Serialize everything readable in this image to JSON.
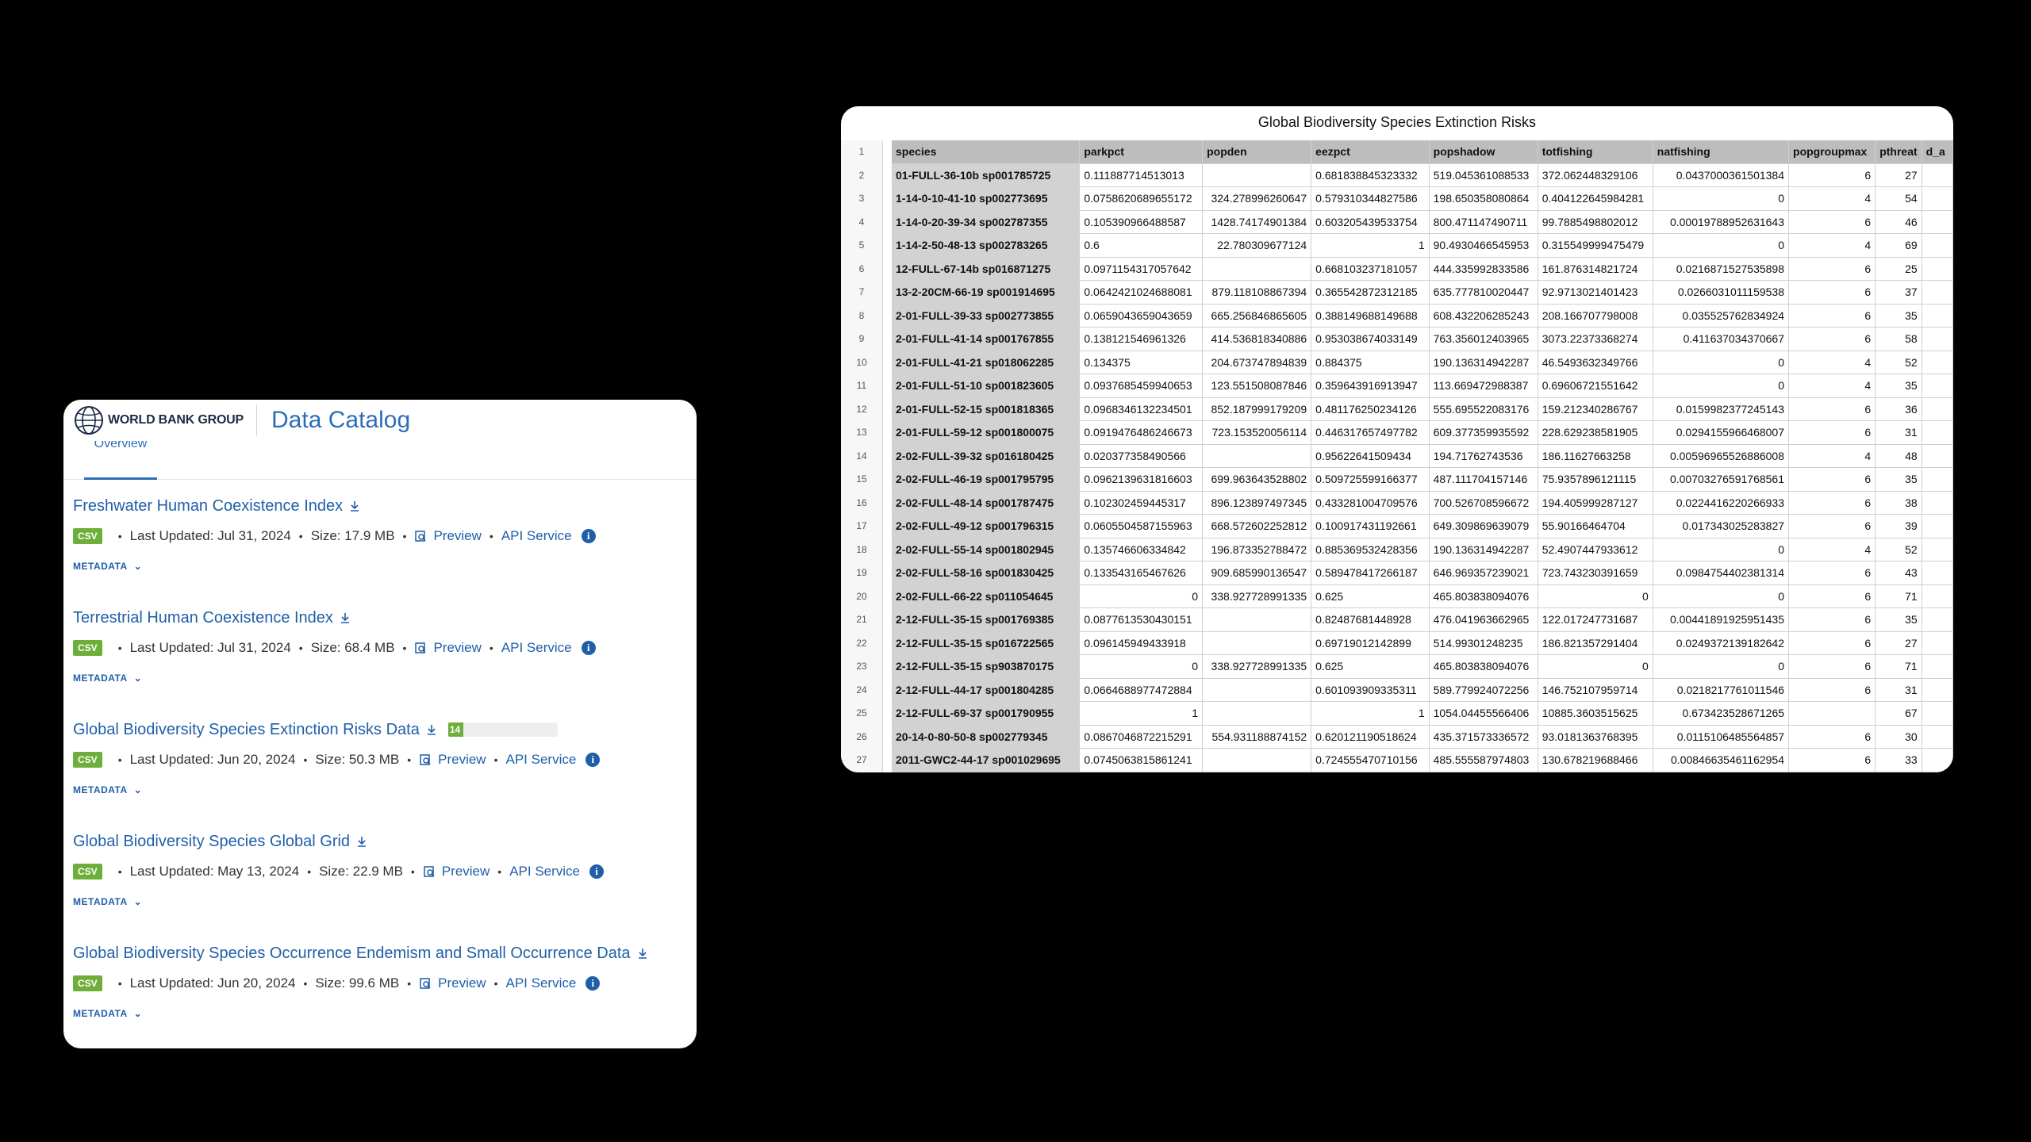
{
  "catalog": {
    "org_name": "WORLD BANK GROUP",
    "title": "Data Catalog",
    "tab": "Overview",
    "datasets": [
      {
        "title": "Freshwater Human Coexistence Index",
        "format": "CSV",
        "updated": "Last Updated: Jul 31, 2024",
        "size": "Size: 17.9 MB",
        "preview": "Preview",
        "api": "API Service",
        "metadata": "METADATA"
      },
      {
        "title": "Terrestrial Human Coexistence Index",
        "format": "CSV",
        "updated": "Last Updated: Jul 31, 2024",
        "size": "Size: 68.4 MB",
        "preview": "Preview",
        "api": "API Service",
        "metadata": "METADATA"
      },
      {
        "title": "Global Biodiversity Species Extinction Risks Data",
        "format": "CSV",
        "updated": "Last Updated: Jun 20, 2024",
        "size": "Size: 50.3 MB",
        "preview": "Preview",
        "api": "API Service",
        "metadata": "METADATA",
        "progress_label": "14",
        "progress_fraction": 0.14
      },
      {
        "title": "Global Biodiversity Species Global Grid",
        "format": "CSV",
        "updated": "Last Updated: May 13, 2024",
        "size": "Size: 22.9 MB",
        "preview": "Preview",
        "api": "API Service",
        "metadata": "METADATA"
      },
      {
        "title": "Global Biodiversity Species Occurrence Endemism and Small Occurrence Data",
        "format": "CSV",
        "updated": "Last Updated: Jun 20, 2024",
        "size": "Size: 99.6 MB",
        "preview": "Preview",
        "api": "API Service",
        "metadata": "METADATA"
      }
    ]
  },
  "sheet": {
    "title": "Global Biodiversity Species Extinction Risks",
    "columns": [
      "species",
      "parkpct",
      "popden",
      "eezpct",
      "popshadow",
      "totfishing",
      "natfishing",
      "popgroupmax",
      "pthreat",
      "d_a"
    ],
    "row_numbers": [
      "1",
      "2",
      "3",
      "4",
      "5",
      "6",
      "7",
      "8",
      "9",
      "10",
      "11",
      "12",
      "13",
      "14",
      "15",
      "16",
      "17",
      "18",
      "19",
      "20",
      "21",
      "22",
      "23",
      "24",
      "25",
      "26",
      "27"
    ],
    "rows": [
      [
        "01-FULL-36-10b sp001785725",
        "0.111887714513013",
        "",
        "0.681838845323332",
        "519.045361088533",
        "372.062448329106",
        "0.0437000361501384",
        "6",
        "27",
        ""
      ],
      [
        "1-14-0-10-41-10 sp002773695",
        "0.0758620689655172",
        "324.278996260647",
        "0.579310344827586",
        "198.650358080864",
        "0.404122645984281",
        "0",
        "4",
        "54",
        ""
      ],
      [
        "1-14-0-20-39-34 sp002787355",
        "0.105390966488587",
        "1428.74174901384",
        "0.603205439533754",
        "800.471147490711",
        "99.7885498802012",
        "0.00019788952631643",
        "6",
        "46",
        ""
      ],
      [
        "1-14-2-50-48-13 sp002783265",
        "0.6",
        "22.780309677124",
        "1",
        "90.4930466545953",
        "0.315549999475479",
        "0",
        "4",
        "69",
        ""
      ],
      [
        "12-FULL-67-14b sp016871275",
        "0.0971154317057642",
        "",
        "0.668103237181057",
        "444.335992833586",
        "161.876314821724",
        "0.0216871527535898",
        "6",
        "25",
        ""
      ],
      [
        "13-2-20CM-66-19 sp001914695",
        "0.0642421024688081",
        "879.118108867394",
        "0.365542872312185",
        "635.777810020447",
        "92.9713021401423",
        "0.0266031011159538",
        "6",
        "37",
        ""
      ],
      [
        "2-01-FULL-39-33 sp002773855",
        "0.0659043659043659",
        "665.256846865605",
        "0.388149688149688",
        "608.432206285243",
        "208.166707798008",
        "0.035525762834924",
        "6",
        "35",
        ""
      ],
      [
        "2-01-FULL-41-14 sp001767855",
        "0.138121546961326",
        "414.536818340886",
        "0.953038674033149",
        "763.356012403965",
        "3073.22373368274",
        "0.411637034370667",
        "6",
        "58",
        ""
      ],
      [
        "2-01-FULL-41-21 sp018062285",
        "0.134375",
        "204.673747894839",
        "0.884375",
        "190.136314942287",
        "46.5493632349766",
        "0",
        "4",
        "52",
        ""
      ],
      [
        "2-01-FULL-51-10 sp001823605",
        "0.0937685459940653",
        "123.551508087846",
        "0.359643916913947",
        "113.669472988387",
        "0.69606721551642",
        "0",
        "4",
        "35",
        ""
      ],
      [
        "2-01-FULL-52-15 sp001818365",
        "0.0968346132234501",
        "852.187999179209",
        "0.481176250234126",
        "555.695522083176",
        "159.212340286767",
        "0.0159982377245143",
        "6",
        "36",
        ""
      ],
      [
        "2-01-FULL-59-12 sp001800075",
        "0.0919476486246673",
        "723.153520056114",
        "0.446317657497782",
        "609.377359935592",
        "228.629238581905",
        "0.0294155966468007",
        "6",
        "31",
        ""
      ],
      [
        "2-02-FULL-39-32 sp016180425",
        "0.020377358490566",
        "",
        "0.95622641509434",
        "194.71762743536",
        "186.11627663258",
        "0.00596965526886008",
        "4",
        "48",
        ""
      ],
      [
        "2-02-FULL-46-19 sp001795795",
        "0.0962139631816603",
        "699.963643528802",
        "0.509725599166377",
        "487.111704157146",
        "75.9357896121115",
        "0.00703276591768561",
        "6",
        "35",
        ""
      ],
      [
        "2-02-FULL-48-14 sp001787475",
        "0.102302459445317",
        "896.123897497345",
        "0.433281004709576",
        "700.526708596672",
        "194.405999287127",
        "0.0224416220266933",
        "6",
        "38",
        ""
      ],
      [
        "2-02-FULL-49-12 sp001796315",
        "0.0605504587155963",
        "668.572602252812",
        "0.100917431192661",
        "649.309869639079",
        "55.90166464704",
        "0.017343025283827",
        "6",
        "39",
        ""
      ],
      [
        "2-02-FULL-55-14 sp001802945",
        "0.135746606334842",
        "196.873352788472",
        "0.885369532428356",
        "190.136314942287",
        "52.4907447933612",
        "0",
        "4",
        "52",
        ""
      ],
      [
        "2-02-FULL-58-16 sp001830425",
        "0.133543165467626",
        "909.685990136547",
        "0.589478417266187",
        "646.969357239021",
        "723.743230391659",
        "0.0984754402381314",
        "6",
        "43",
        ""
      ],
      [
        "2-02-FULL-66-22 sp011054645",
        "0",
        "338.927728991335",
        "0.625",
        "465.803838094076",
        "0",
        "0",
        "6",
        "71",
        ""
      ],
      [
        "2-12-FULL-35-15 sp001769385",
        "0.0877613530430151",
        "",
        "0.82487681448928",
        "476.041963662965",
        "122.017247731687",
        "0.00441891925951435",
        "6",
        "35",
        ""
      ],
      [
        "2-12-FULL-35-15 sp016722565",
        "0.096145949433918",
        "",
        "0.69719012142899",
        "514.99301248235",
        "186.821357291404",
        "0.0249372139182642",
        "6",
        "27",
        ""
      ],
      [
        "2-12-FULL-35-15 sp903870175",
        "0",
        "338.927728991335",
        "0.625",
        "465.803838094076",
        "0",
        "0",
        "6",
        "71",
        ""
      ],
      [
        "2-12-FULL-44-17 sp001804285",
        "0.0664688977472884",
        "",
        "0.601093909335311",
        "589.779924072256",
        "146.752107959714",
        "0.0218217761011546",
        "6",
        "31",
        ""
      ],
      [
        "2-12-FULL-69-37 sp001790955",
        "1",
        "",
        "1",
        "1054.04455566406",
        "10885.3603515625",
        "0.673423528671265",
        "",
        "67",
        ""
      ],
      [
        "20-14-0-80-50-8 sp002779345",
        "0.0867046872215291",
        "554.931188874152",
        "0.620121190518624",
        "435.371573336572",
        "93.0181363768395",
        "0.0115106485564857",
        "6",
        "30",
        ""
      ],
      [
        "2011-GWC2-44-17 sp001029695",
        "0.0745063815861241",
        "",
        "0.724555470710156",
        "485.555587974803",
        "130.678219688466",
        "0.00846635461162954",
        "6",
        "33",
        ""
      ]
    ]
  }
}
